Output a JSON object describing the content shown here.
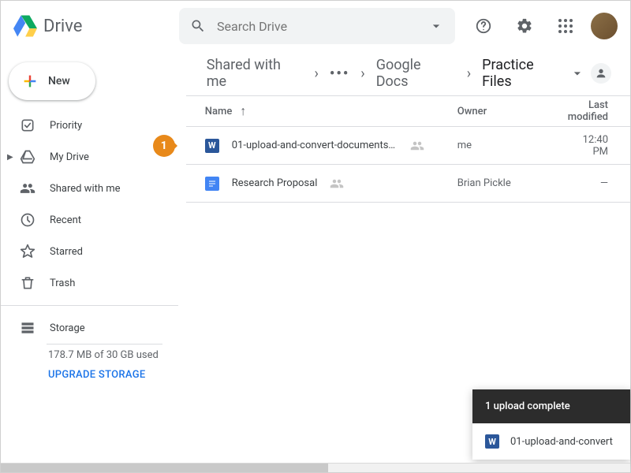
{
  "header": {
    "app_name": "Drive",
    "search_placeholder": "Search Drive"
  },
  "sidebar": {
    "new_label": "New",
    "items": [
      {
        "label": "Priority"
      },
      {
        "label": "My Drive"
      },
      {
        "label": "Shared with me"
      },
      {
        "label": "Recent"
      },
      {
        "label": "Starred"
      },
      {
        "label": "Trash"
      }
    ],
    "storage": {
      "label": "Storage",
      "used": "178.7 MB of 30 GB used",
      "upgrade": "UPGRADE STORAGE"
    }
  },
  "breadcrumb": {
    "items": [
      "Shared with me",
      "…",
      "Google Docs",
      "Practice Files"
    ]
  },
  "list": {
    "headers": {
      "name": "Name",
      "owner": "Owner",
      "modified": "Last modified"
    },
    "rows": [
      {
        "type": "word",
        "name": "01-upload-and-convert-documents.d…",
        "owner": "me",
        "modified": "12:40 PM",
        "shared": true
      },
      {
        "type": "gdoc",
        "name": "Research Proposal",
        "owner": "Brian Pickle",
        "modified": "—",
        "shared": true
      }
    ]
  },
  "callout": {
    "number": "1"
  },
  "toast": {
    "title": "1 upload complete",
    "file": "01-upload-and-convert",
    "file_type": "word"
  }
}
